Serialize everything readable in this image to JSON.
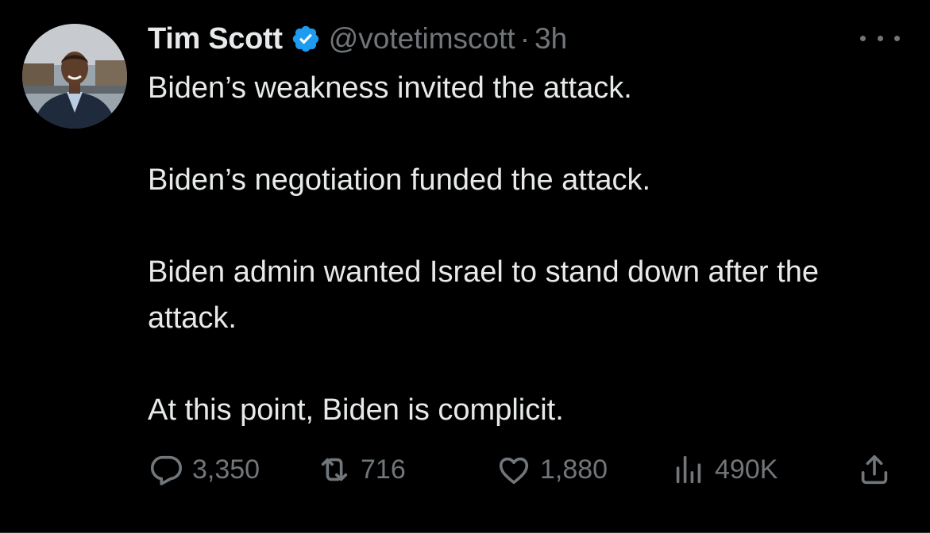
{
  "tweet": {
    "author": {
      "display_name": "Tim Scott",
      "handle": "@votetimscott",
      "verified": true,
      "verified_color": "#1d9bf0"
    },
    "separator": "·",
    "time": "3h",
    "paragraphs": [
      "Biden’s weakness invited the attack.",
      "Biden’s negotiation funded the attack.",
      "Biden admin wanted Israel to stand down after the attack.",
      "At this point, Biden is complicit."
    ],
    "actions": {
      "replies": "3,350",
      "reposts": "716",
      "likes": "1,880",
      "views": "490K"
    },
    "icons": {
      "reply": "reply-icon",
      "repost": "repost-icon",
      "like": "heart-icon",
      "views": "views-chart-icon",
      "share": "share-icon",
      "more": "more-icon"
    }
  },
  "colors": {
    "background": "#000000",
    "text_primary": "#e7e9ea",
    "text_secondary": "#71767b",
    "accent": "#1d9bf0"
  }
}
